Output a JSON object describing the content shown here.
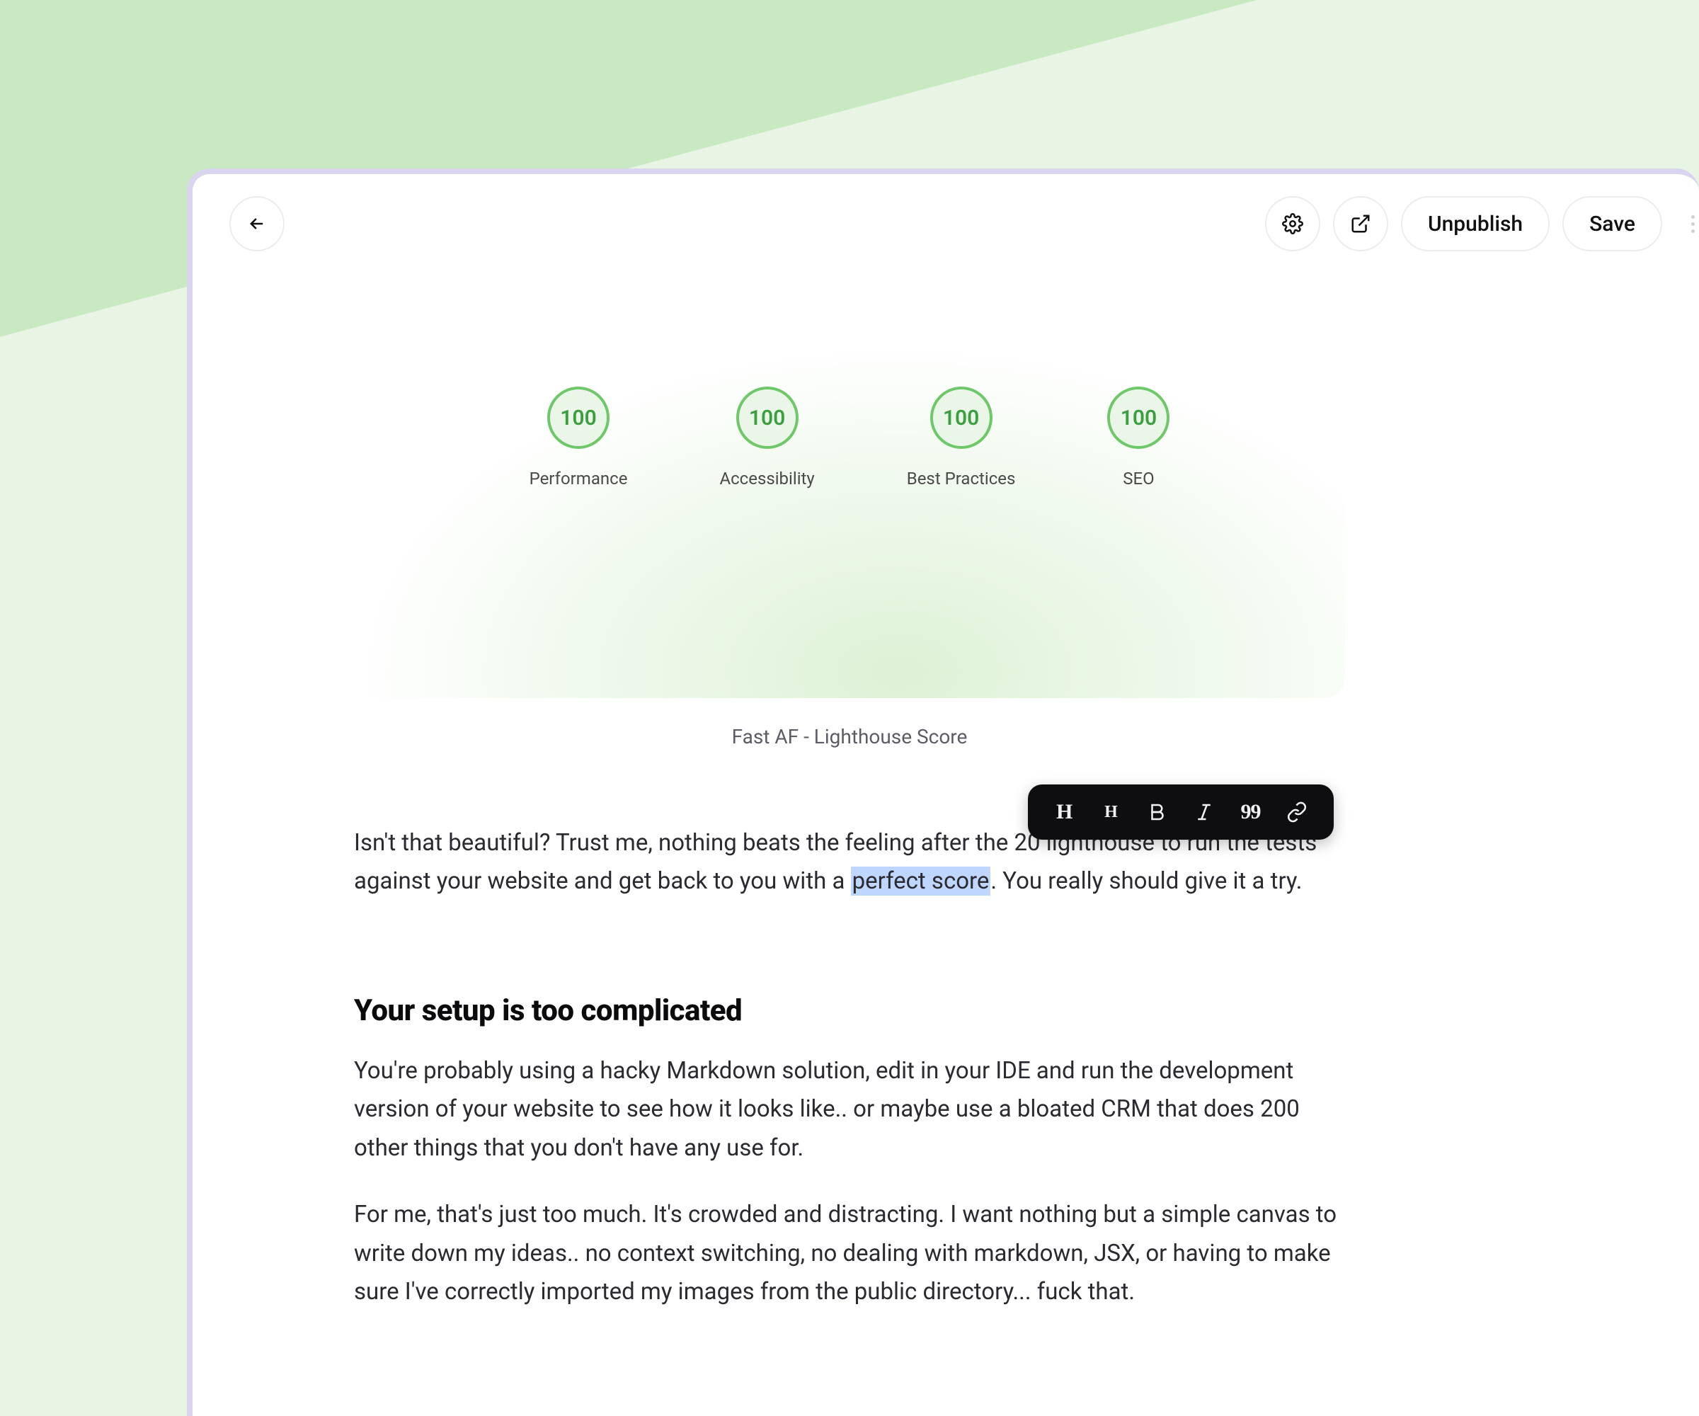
{
  "topbar": {
    "unpublish_label": "Unpublish",
    "save_label": "Save"
  },
  "hero": {
    "scores": [
      {
        "value": "100",
        "label": "Performance"
      },
      {
        "value": "100",
        "label": "Accessibility"
      },
      {
        "value": "100",
        "label": "Best Practices"
      },
      {
        "value": "100",
        "label": "SEO"
      }
    ],
    "caption": "Fast AF - Lighthouse Score"
  },
  "editor": {
    "para1_before": "Isn't that beautiful? Trust me, nothing beats the feeling after the 20 lighthouse to run the tests against your website and get back to you with a ",
    "para1_highlight": "perfect score",
    "para1_after": ". You really should give it a try.",
    "heading": "Your setup is too complicated",
    "para2": "You're probably using a hacky Markdown solution, edit in your IDE and run the development version of your website to see how it looks like.. or maybe use a bloated CRM that does 200 other things that you don't have any use for.",
    "para3": "For me, that's just too much. It's crowded and distracting. I want nothing but a simple canvas to write down my ideas.. no context switching, no dealing with markdown, JSX, or having to make sure I've correctly imported my images from the public directory... fuck that."
  },
  "format_toolbar": {
    "h1": "H",
    "h2": "H",
    "quote": "99"
  }
}
